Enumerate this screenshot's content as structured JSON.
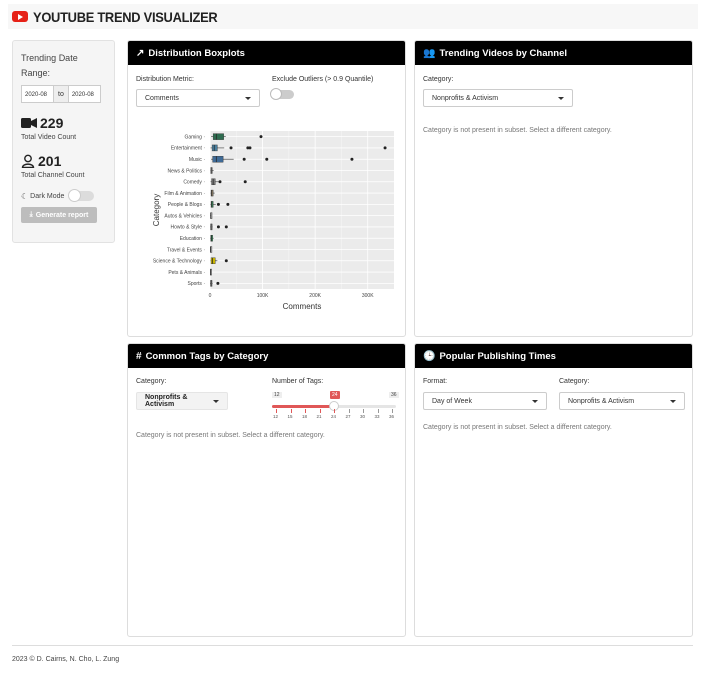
{
  "app": {
    "title": "YOUTUBE TREND VISUALIZER"
  },
  "sidebar": {
    "date_label": "Trending Date Range:",
    "start_date": "2020-08",
    "to": "to",
    "end_date": "2020-08",
    "video_count": "229",
    "video_count_label": "Total Video Count",
    "channel_count": "201",
    "channel_count_label": "Total Channel Count",
    "dark_mode_label": "Dark Mode",
    "report_button": "Generate report"
  },
  "boxplot_card": {
    "title": "Distribution Boxplots",
    "metric_label": "Distribution Metric:",
    "metric_value": "Comments",
    "outliers_label": "Exclude Outliers (> 0.9 Quantile)"
  },
  "channel_card": {
    "title": "Trending Videos by Channel",
    "category_label": "Category:",
    "category_value": "Nonprofits & Activism",
    "message": "Category is not present in subset. Select a different category."
  },
  "tags_card": {
    "title": "Common Tags by Category",
    "category_label": "Category:",
    "category_value": "Nonprofits & Activism",
    "tags_label": "Number of Tags:",
    "slider_min": "12",
    "slider_value": "24",
    "slider_max": "36",
    "slider_ticks": [
      "12",
      "15",
      "18",
      "21",
      "24",
      "27",
      "30",
      "33",
      "36"
    ],
    "message": "Category is not present in subset. Select a different category."
  },
  "times_card": {
    "title": "Popular Publishing Times",
    "format_label": "Format:",
    "format_value": "Day of Week",
    "category_label": "Category:",
    "category_value": "Nonprofits & Activism",
    "message": "Category is not present in subset. Select a different category."
  },
  "footer": {
    "text": "2023 © D. Cairns, N. Cho, L. Zung"
  },
  "chart_data": {
    "type": "boxplot",
    "xlabel": "Comments",
    "ylabel": "Category",
    "xlim": [
      0,
      350000
    ],
    "xticks": [
      "0",
      "100K",
      "200K",
      "300K"
    ],
    "xtick_values": [
      0,
      100000,
      200000,
      300000
    ],
    "grid": true,
    "categories": [
      "Gaming",
      "Entertainment",
      "Music",
      "News & Politics",
      "Comedy",
      "Film & Animation",
      "People & Blogs",
      "Autos & Vehicles",
      "Howto & Style",
      "Education",
      "Travel & Events",
      "Science & Technology",
      "Pets & Animals",
      "Sports"
    ],
    "colors": [
      "#2e6b4f",
      "#4a7f9e",
      "#3e6a96",
      "#b0b0b0",
      "#7a7a7a",
      "#9a8a70",
      "#3f8a5e",
      "#b0b0b0",
      "#8a8a8a",
      "#2e8b57",
      "#b0b0b0",
      "#c8b400",
      "#b0b0b0",
      "#8a8a8a"
    ],
    "boxes": [
      {
        "whisker_low": 2000,
        "q1": 6000,
        "median": 12000,
        "q3": 26000,
        "whisker_high": 30000,
        "outliers": [
          97000
        ]
      },
      {
        "whisker_low": 1000,
        "q1": 4000,
        "median": 8000,
        "q3": 14000,
        "whisker_high": 27000,
        "outliers": [
          40000,
          72000,
          76000,
          333000
        ]
      },
      {
        "whisker_low": 2000,
        "q1": 5000,
        "median": 12000,
        "q3": 25000,
        "whisker_high": 45000,
        "outliers": [
          65000,
          108000,
          270000
        ]
      },
      {
        "whisker_low": 800,
        "q1": 1500,
        "median": 2500,
        "q3": 4000,
        "whisker_high": 7000,
        "outliers": []
      },
      {
        "whisker_low": 1000,
        "q1": 3000,
        "median": 6000,
        "q3": 10000,
        "whisker_high": 16000,
        "outliers": [
          19000,
          67000
        ]
      },
      {
        "whisker_low": 1000,
        "q1": 2000,
        "median": 3500,
        "q3": 6000,
        "whisker_high": 9000,
        "outliers": []
      },
      {
        "whisker_low": 800,
        "q1": 2000,
        "median": 3500,
        "q3": 6000,
        "whisker_high": 11000,
        "outliers": [
          16000,
          34000
        ]
      },
      {
        "whisker_low": 500,
        "q1": 1000,
        "median": 1500,
        "q3": 2200,
        "whisker_high": 3000,
        "outliers": []
      },
      {
        "whisker_low": 500,
        "q1": 1200,
        "median": 2000,
        "q3": 3500,
        "whisker_high": 5000,
        "outliers": [
          16000,
          31000
        ]
      },
      {
        "whisker_low": 500,
        "q1": 1500,
        "median": 2500,
        "q3": 5000,
        "whisker_high": 7000,
        "outliers": []
      },
      {
        "whisker_low": 500,
        "q1": 800,
        "median": 1200,
        "q3": 1800,
        "whisker_high": 2500,
        "outliers": []
      },
      {
        "whisker_low": 1000,
        "q1": 2000,
        "median": 5000,
        "q3": 10000,
        "whisker_high": 14000,
        "outliers": [
          31000
        ]
      },
      {
        "whisker_low": 200,
        "q1": 500,
        "median": 800,
        "q3": 1200,
        "whisker_high": 1500,
        "outliers": []
      },
      {
        "whisker_low": 200,
        "q1": 1000,
        "median": 2000,
        "q3": 3500,
        "whisker_high": 5000,
        "outliers": [
          15000
        ]
      }
    ]
  }
}
